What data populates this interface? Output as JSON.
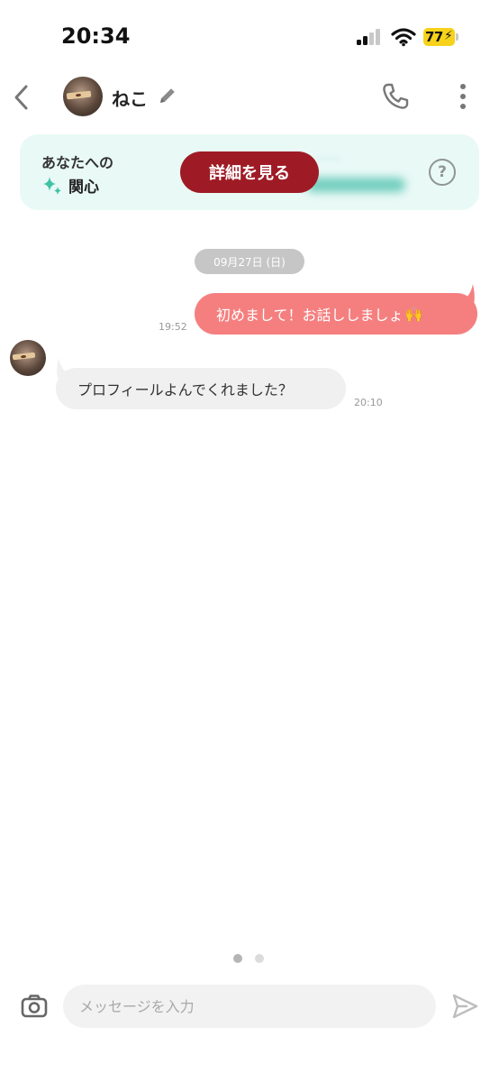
{
  "status_bar": {
    "time": "20:34",
    "battery_level": "77"
  },
  "header": {
    "partner_name": "ねこ",
    "icons": [
      "back-icon",
      "edit-icon",
      "phone-icon",
      "more-icon"
    ]
  },
  "interest_card": {
    "line1": "あなたへの",
    "line2": "関心",
    "details_label": "詳細を見る",
    "help_label": "?",
    "accent_color": "#e9f9f6",
    "button_color": "#9e1b25"
  },
  "conversation": {
    "date_label": "09月27日 (日)",
    "messages": [
      {
        "direction": "sent",
        "text": "初めまして！お話ししましょ",
        "emoji": "🙌",
        "time": "19:52",
        "color": "#f57f7f"
      },
      {
        "direction": "received",
        "text": "プロフィールよんでくれました？",
        "time": "20:10",
        "color": "#f0f0f0"
      }
    ]
  },
  "pager": {
    "active_index": 0,
    "count": 2
  },
  "composer": {
    "placeholder": "メッセージを入力",
    "value": ""
  }
}
